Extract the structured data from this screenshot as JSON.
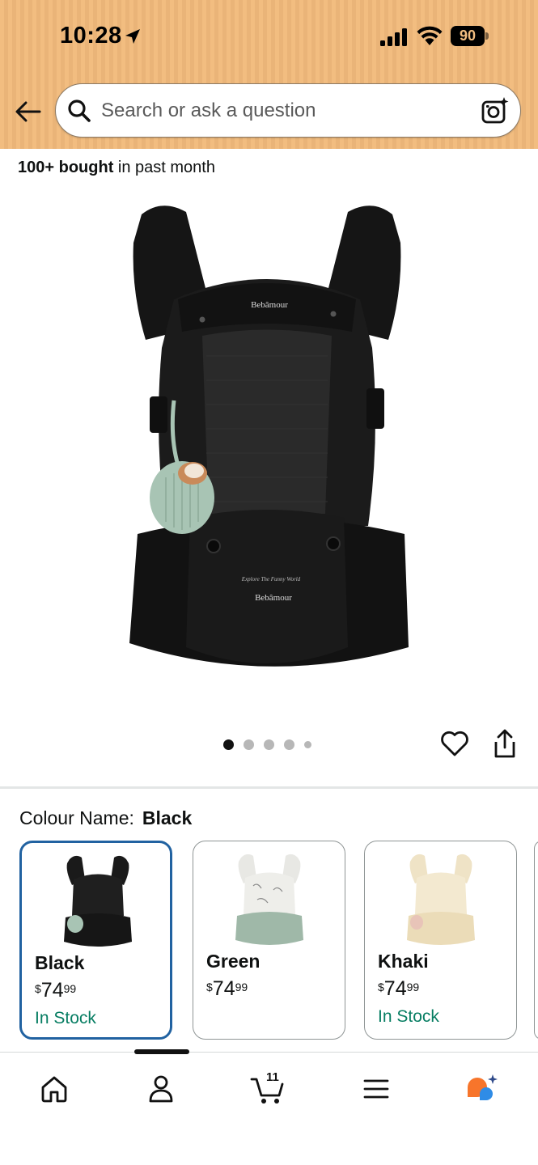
{
  "status_bar": {
    "time": "10:28",
    "battery": "90"
  },
  "search": {
    "placeholder": "Search or ask a question"
  },
  "product": {
    "bought_bold": "100+ bought",
    "bought_rest": " in past month",
    "image_brand": "Bebâmour",
    "image_tagline": "Explore The Funny World",
    "image_count": 5,
    "active_image_index": 0
  },
  "colour": {
    "label": "Colour Name:",
    "selected": "Black",
    "options": [
      {
        "name": "Black",
        "currency": "$",
        "whole": "74",
        "fraction": "99",
        "stock": "In Stock",
        "color": "#1a1a1a",
        "selected": true
      },
      {
        "name": "Green",
        "currency": "$",
        "whole": "74",
        "fraction": "99",
        "stock": "",
        "color": "#9fb8a8",
        "selected": false
      },
      {
        "name": "Khaki",
        "currency": "$",
        "whole": "74",
        "fraction": "99",
        "stock": "In Stock",
        "color": "#efe3c6",
        "selected": false
      }
    ]
  },
  "bottom_nav": {
    "items": [
      "home-icon",
      "account-icon",
      "cart-icon",
      "menu-icon",
      "rufus-icon"
    ],
    "cart_count": "11"
  },
  "colors": {
    "header_bg": "#f2bd80",
    "selected_border": "#2162a1",
    "in_stock": "#067d62",
    "rufus_orange": "#f7752b",
    "rufus_blue": "#2f8ce6"
  }
}
